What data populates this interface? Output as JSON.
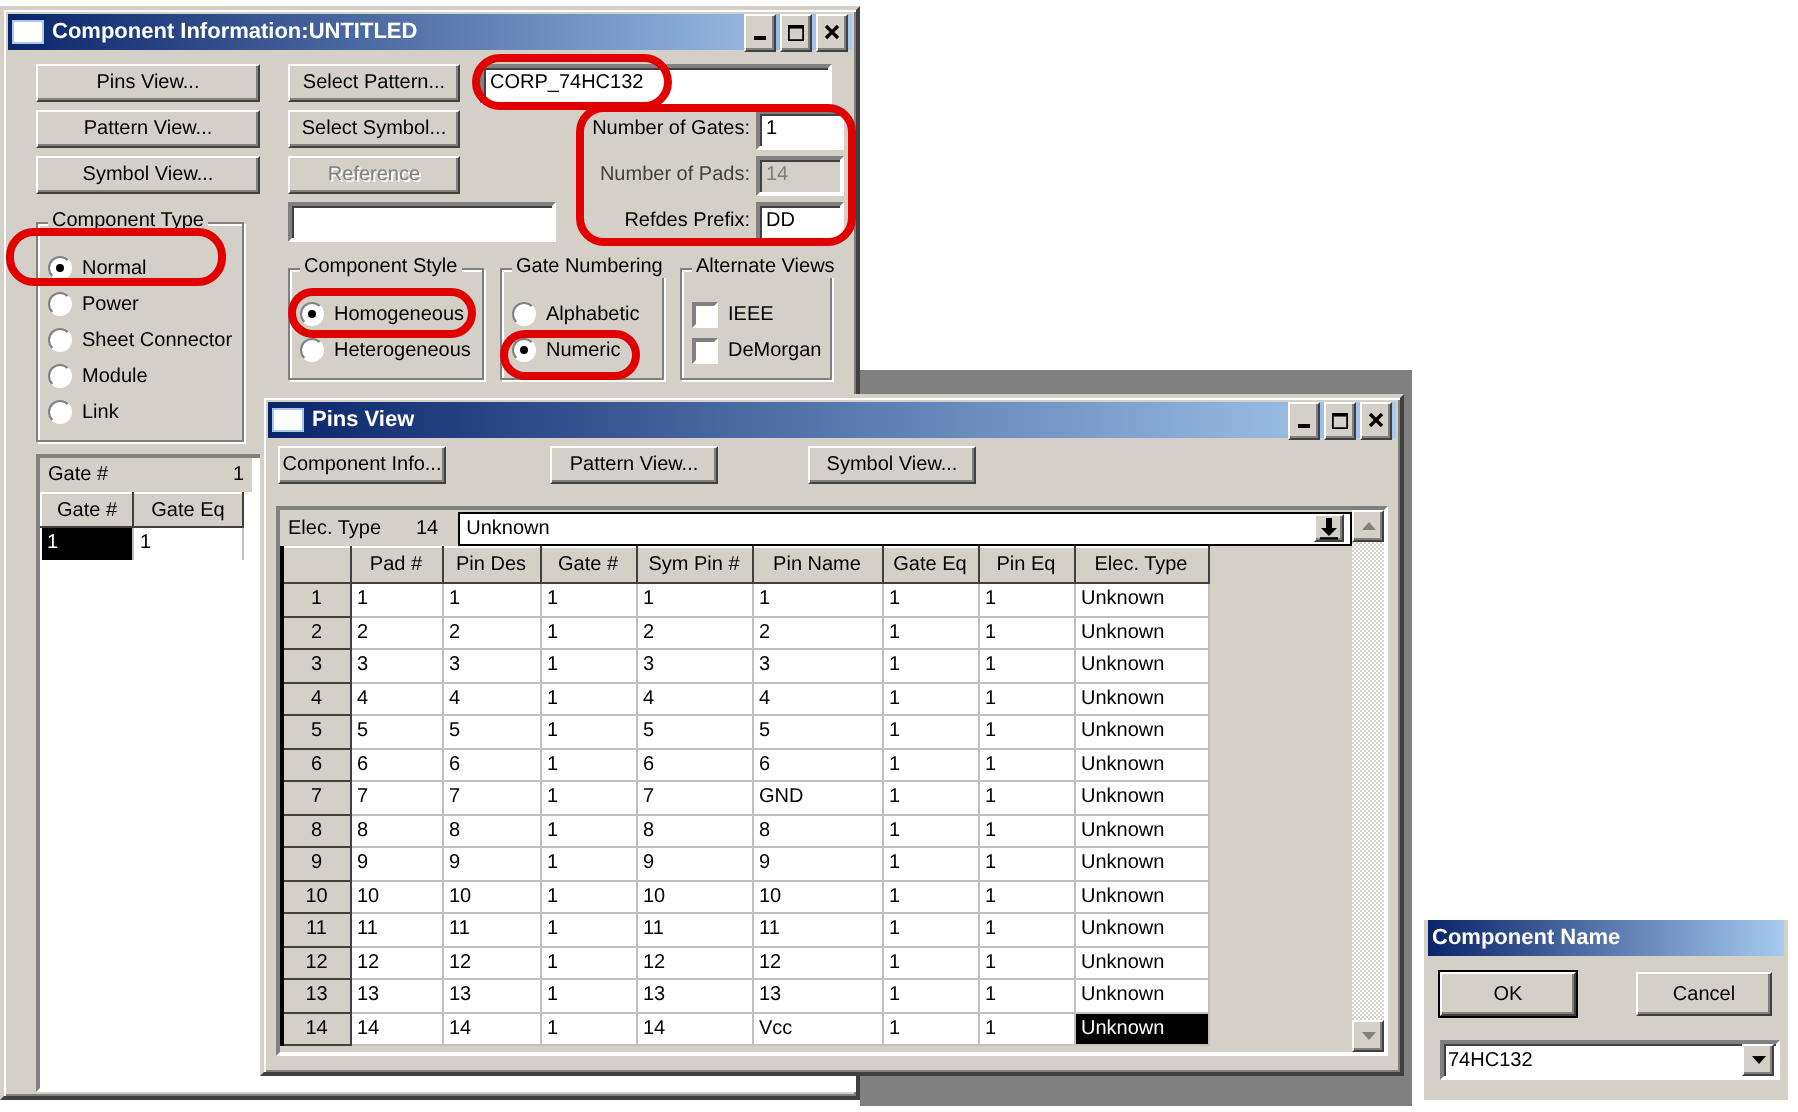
{
  "component_window": {
    "title": "Component Information:UNTITLED",
    "view_buttons": [
      {
        "label": "Pins View..."
      },
      {
        "label": "Pattern View..."
      },
      {
        "label": "Symbol View..."
      }
    ],
    "select_buttons": [
      {
        "label": "Select Pattern...",
        "disabled": false
      },
      {
        "label": "Select Symbol...",
        "disabled": false
      },
      {
        "label": "Reference",
        "disabled": true
      }
    ],
    "pattern_field": {
      "value": "CORP_74HC132"
    },
    "fields": [
      {
        "label": "Number of Gates:",
        "value": "1",
        "disabled": false
      },
      {
        "label": "Number of Pads:",
        "value": "14",
        "disabled": true
      },
      {
        "label": "Refdes Prefix:",
        "value": "DD",
        "disabled": false
      }
    ],
    "component_type": {
      "title": "Component Type",
      "options": [
        {
          "label": "Normal",
          "selected": true
        },
        {
          "label": "Power",
          "selected": false
        },
        {
          "label": "Sheet Connector",
          "selected": false
        },
        {
          "label": "Module",
          "selected": false
        },
        {
          "label": "Link",
          "selected": false
        }
      ]
    },
    "component_style": {
      "title": "Component Style",
      "options": [
        {
          "label": "Homogeneous",
          "selected": true
        },
        {
          "label": "Heterogeneous",
          "selected": false
        }
      ]
    },
    "gate_numbering": {
      "title": "Gate Numbering",
      "options": [
        {
          "label": "Alphabetic",
          "selected": false
        },
        {
          "label": "Numeric",
          "selected": true
        }
      ]
    },
    "alternate_views": {
      "title": "Alternate Views",
      "options": [
        {
          "label": "IEEE",
          "checked": false
        },
        {
          "label": "DeMorgan",
          "checked": false
        }
      ]
    },
    "gate_table": {
      "summary_label": "Gate #",
      "summary_value": "1",
      "columns": [
        "Gate #",
        "Gate Eq"
      ],
      "rows": [
        {
          "cells": [
            "1",
            "1"
          ],
          "selected": true
        }
      ]
    }
  },
  "pins_window": {
    "title": "Pins View",
    "buttons": [
      {
        "label": "Component Info..."
      },
      {
        "label": "Pattern View..."
      },
      {
        "label": "Symbol View..."
      }
    ],
    "elec_type": {
      "label": "Elec. Type",
      "count": "14",
      "value": "Unknown"
    },
    "columns": [
      "Pad #",
      "Pin Des",
      "Gate #",
      "Sym Pin #",
      "Pin Name",
      "Gate Eq",
      "Pin Eq",
      "Elec. Type"
    ],
    "rows": [
      {
        "num": "1",
        "cells": [
          "1",
          "1",
          "1",
          "1",
          "1",
          "1",
          "1",
          "Unknown"
        ],
        "selected": false
      },
      {
        "num": "2",
        "cells": [
          "2",
          "2",
          "1",
          "2",
          "2",
          "1",
          "1",
          "Unknown"
        ],
        "selected": false
      },
      {
        "num": "3",
        "cells": [
          "3",
          "3",
          "1",
          "3",
          "3",
          "1",
          "1",
          "Unknown"
        ],
        "selected": false
      },
      {
        "num": "4",
        "cells": [
          "4",
          "4",
          "1",
          "4",
          "4",
          "1",
          "1",
          "Unknown"
        ],
        "selected": false
      },
      {
        "num": "5",
        "cells": [
          "5",
          "5",
          "1",
          "5",
          "5",
          "1",
          "1",
          "Unknown"
        ],
        "selected": false
      },
      {
        "num": "6",
        "cells": [
          "6",
          "6",
          "1",
          "6",
          "6",
          "1",
          "1",
          "Unknown"
        ],
        "selected": false
      },
      {
        "num": "7",
        "cells": [
          "7",
          "7",
          "1",
          "7",
          "GND",
          "1",
          "1",
          "Unknown"
        ],
        "selected": false
      },
      {
        "num": "8",
        "cells": [
          "8",
          "8",
          "1",
          "8",
          "8",
          "1",
          "1",
          "Unknown"
        ],
        "selected": false
      },
      {
        "num": "9",
        "cells": [
          "9",
          "9",
          "1",
          "9",
          "9",
          "1",
          "1",
          "Unknown"
        ],
        "selected": false
      },
      {
        "num": "10",
        "cells": [
          "10",
          "10",
          "1",
          "10",
          "10",
          "1",
          "1",
          "Unknown"
        ],
        "selected": false
      },
      {
        "num": "11",
        "cells": [
          "11",
          "11",
          "1",
          "11",
          "11",
          "1",
          "1",
          "Unknown"
        ],
        "selected": false
      },
      {
        "num": "12",
        "cells": [
          "12",
          "12",
          "1",
          "12",
          "12",
          "1",
          "1",
          "Unknown"
        ],
        "selected": false
      },
      {
        "num": "13",
        "cells": [
          "13",
          "13",
          "1",
          "13",
          "13",
          "1",
          "1",
          "Unknown"
        ],
        "selected": false
      },
      {
        "num": "14",
        "cells": [
          "14",
          "14",
          "1",
          "14",
          "Vcc",
          "1",
          "1",
          "Unknown"
        ],
        "selected": true
      }
    ]
  },
  "name_dialog": {
    "title": "Component Name",
    "buttons": [
      {
        "label": "OK",
        "default": true
      },
      {
        "label": "Cancel",
        "default": false
      }
    ],
    "combo": {
      "value": "74HC132"
    }
  }
}
